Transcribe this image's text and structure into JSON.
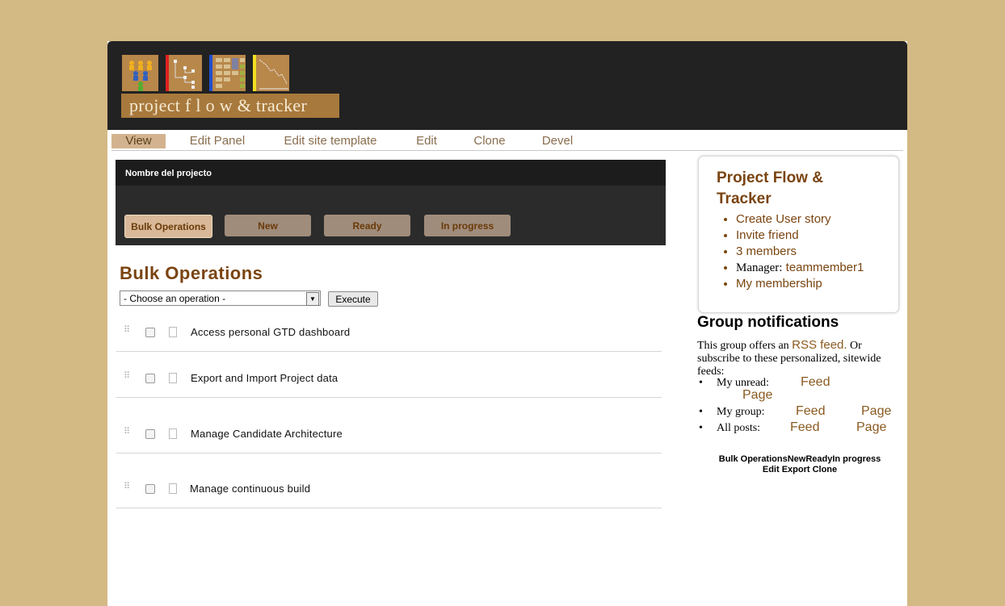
{
  "header": {
    "logo_text": "project f l o w & tracker"
  },
  "tabs": [
    "View",
    "Edit Panel",
    "Edit site template",
    "Edit",
    "Clone",
    "Devel"
  ],
  "panel": {
    "title": "Nombre del projecto",
    "view_tabs": [
      "Bulk Operations",
      "New",
      "Ready",
      "In progress"
    ]
  },
  "main": {
    "title": "Bulk Operations",
    "select_value": "- Choose an operation -",
    "execute_label": "Execute",
    "rows": [
      "Access personal GTD dashboard",
      "Export and Import Project data",
      "Manage Candidate Architecture",
      "Manage continuous build"
    ]
  },
  "sidebar": {
    "title": "Project Flow & Tracker",
    "links": {
      "create": "Create User story",
      "invite": "Invite friend",
      "members": "3 members",
      "manager_label": "Manager:",
      "manager_name": "teammember1",
      "membership": "My membership"
    }
  },
  "notifications": {
    "title": "Group notifications",
    "desc_before": "This group offers an",
    "rss_link": "RSS feed.",
    "desc_after": "Or subscribe to these personalized, sitewide feeds:",
    "items": [
      {
        "label": "My unread:",
        "feed": "Feed",
        "page": "Page"
      },
      {
        "label": "My group:",
        "feed": "Feed",
        "page": "Page"
      },
      {
        "label": "All posts:",
        "feed": "Feed",
        "page": "Page"
      }
    ]
  },
  "bottom_links": {
    "line1": "Bulk OperationsNewReadyIn progress",
    "line2": "Edit Export Clone"
  },
  "colors": {
    "background": "#d3b984",
    "header": "#222222",
    "accent_brown": "#7a4410",
    "tab_active": "#d3b38f"
  }
}
